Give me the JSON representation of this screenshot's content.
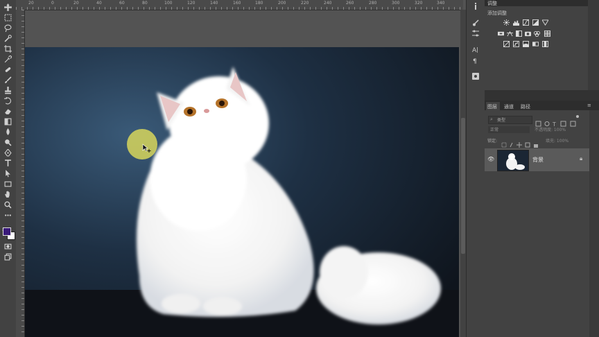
{
  "ruler": {
    "labels": [
      "20",
      "0",
      "20",
      "40",
      "60",
      "80",
      "100",
      "120",
      "140",
      "160",
      "180",
      "200",
      "220",
      "240",
      "260",
      "280",
      "300",
      "320",
      "340"
    ]
  },
  "adjustments": {
    "tab_label": "调整",
    "add_label": "添加调整"
  },
  "layers": {
    "tabs": [
      "图层",
      "通道",
      "路径"
    ],
    "filter_placeholder": "类型",
    "blend_mode": "正常",
    "opacity_label": "不透明度: 100%",
    "lock_label": "锁定:",
    "fill_label": "填充: 100%",
    "layer_name": "背景"
  },
  "colors": {
    "foreground": "#3a1a7a",
    "background": "#ffffff",
    "cursor": "#e6e25a"
  }
}
